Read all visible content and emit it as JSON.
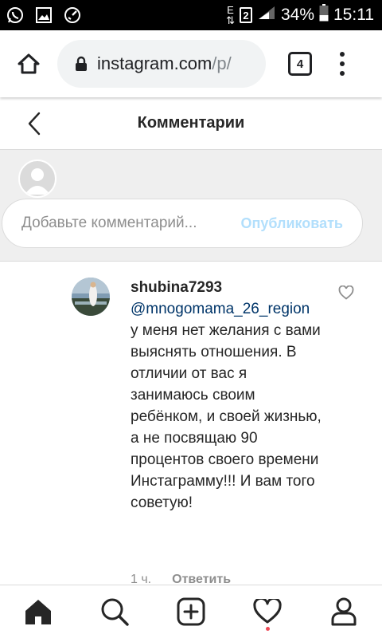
{
  "status_bar": {
    "network_letter": "E",
    "sim_number": "2",
    "battery": "34%",
    "time": "15:11",
    "left_icons": [
      "whatsapp-icon",
      "gallery-icon",
      "speed-icon"
    ]
  },
  "browser": {
    "url_host": "instagram.com",
    "url_path": "/p/",
    "tab_count": "4"
  },
  "header": {
    "title": "Комментарии"
  },
  "composer": {
    "placeholder": "Добавьте комментарий...",
    "publish_label": "Опубликовать"
  },
  "comment": {
    "username": "shubina7293",
    "mention": "@mnogomama_26_region",
    "text": "у меня нет желания с вами выяснять отношения. В отличии от вас я занимаюсь своим ребёнком, и своей жизнью, а не посвящаю 90 процентов своего времени Инстаграмму!!! И вам того советую!",
    "time": "1 ч.",
    "reply_label": "Ответить"
  },
  "bottom_nav": {
    "items": [
      "home-icon",
      "search-icon",
      "new-post-icon",
      "activity-icon",
      "profile-icon"
    ],
    "notification_color": "#ed4956"
  }
}
